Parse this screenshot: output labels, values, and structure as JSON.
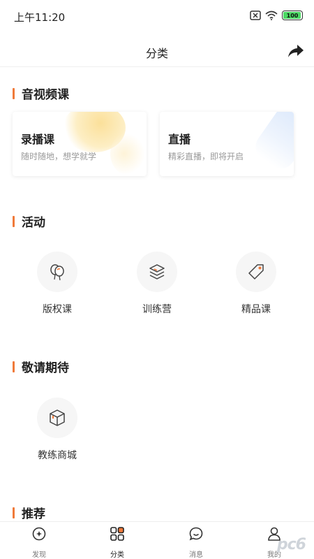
{
  "status_bar": {
    "time": "上午11:20",
    "battery": "100"
  },
  "nav": {
    "title": "分类",
    "share_icon": "share-icon"
  },
  "sections": {
    "media": {
      "title": "音视频课",
      "cards": [
        {
          "title": "录播课",
          "subtitle": "随时随地，想学就学"
        },
        {
          "title": "直播",
          "subtitle": "精彩直播，即将开启"
        }
      ]
    },
    "activity": {
      "title": "活动",
      "items": [
        {
          "label": "版权课",
          "icon": "balloon-icon"
        },
        {
          "label": "训练营",
          "icon": "layers-icon"
        },
        {
          "label": "精品课",
          "icon": "tag-icon"
        }
      ]
    },
    "coming_soon": {
      "title": "敬请期待",
      "items": [
        {
          "label": "教练商城",
          "icon": "box-icon"
        }
      ]
    },
    "recommend": {
      "title": "推荐"
    }
  },
  "tabs": [
    {
      "label": "发现",
      "icon": "discover-icon"
    },
    {
      "label": "分类",
      "icon": "category-icon"
    },
    {
      "label": "消息",
      "icon": "message-icon"
    },
    {
      "label": "我的",
      "icon": "profile-icon"
    }
  ],
  "watermark": "pc6",
  "colors": {
    "accent": "#f07a3a",
    "battery": "#4cd964"
  }
}
